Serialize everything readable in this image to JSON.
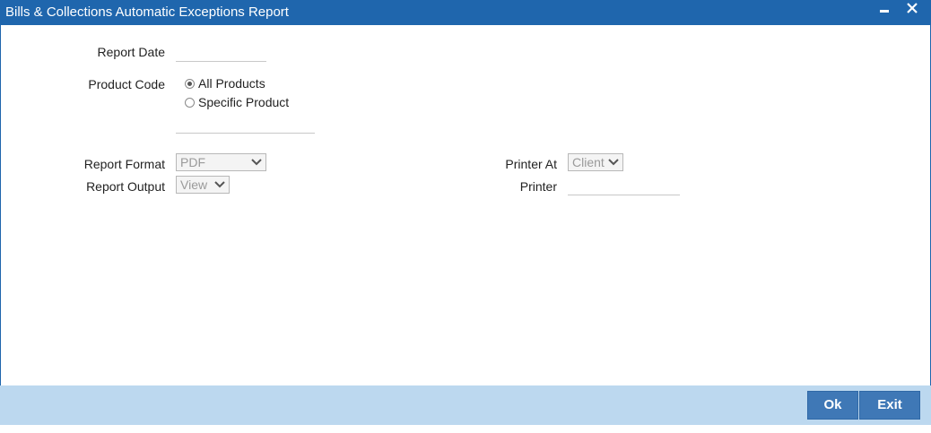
{
  "window": {
    "title": "Bills & Collections Automatic Exceptions Report"
  },
  "form": {
    "report_date_label": "Report Date",
    "report_date_value": "",
    "product_code_label": "Product Code",
    "product_options": [
      {
        "label": "All Products",
        "selected": true
      },
      {
        "label": "Specific Product",
        "selected": false
      }
    ],
    "specific_product_value": "",
    "report_format_label": "Report Format",
    "report_format_value": "PDF",
    "report_output_label": "Report Output",
    "report_output_value": "View",
    "printer_at_label": "Printer At",
    "printer_at_value": "Client",
    "printer_label": "Printer",
    "printer_value": ""
  },
  "footer": {
    "ok_label": "Ok",
    "exit_label": "Exit"
  },
  "colors": {
    "title_bar": "#1f66ad",
    "footer": "#bcd8ef",
    "button": "#3f78b6"
  },
  "icons": {
    "minimize": "minimize-icon",
    "close": "close-icon",
    "dropdown": "chevron-down-icon"
  }
}
